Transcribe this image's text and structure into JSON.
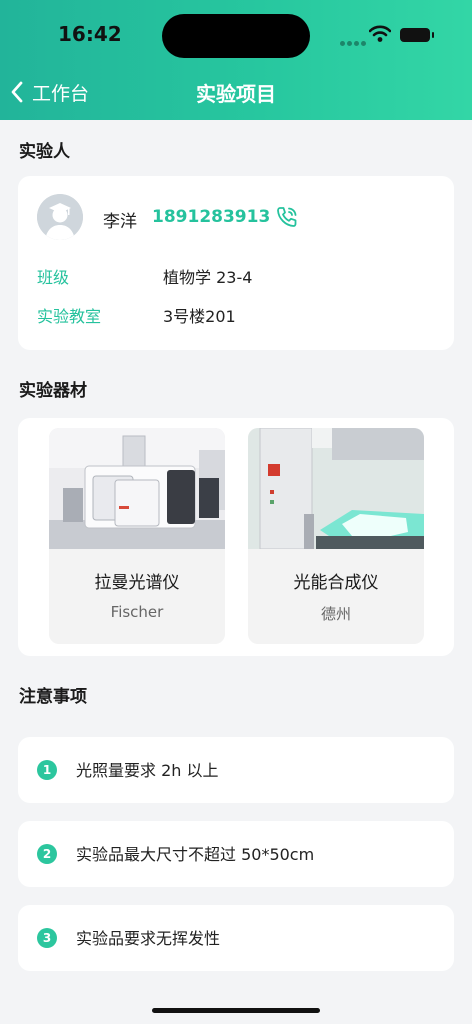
{
  "status_bar": {
    "time": "16:42"
  },
  "nav": {
    "back_label": "工作台",
    "title": "实验项目"
  },
  "experimenter": {
    "section_title": "实验人",
    "name": "李洋",
    "phone": "1891283913",
    "fields": [
      {
        "label": "班级",
        "value": "植物学 23-4"
      },
      {
        "label": "实验教室",
        "value": "3号楼201"
      }
    ]
  },
  "equipment": {
    "section_title": "实验器材",
    "items": [
      {
        "name": "拉曼光谱仪",
        "sub": "Fischer"
      },
      {
        "name": "光能合成仪",
        "sub": "德州"
      }
    ]
  },
  "notes": {
    "section_title": "注意事项",
    "items": [
      {
        "num": "1",
        "text": "光照量要求 2h 以上"
      },
      {
        "num": "2",
        "text": "实验品最大尺寸不超过 50*50cm"
      },
      {
        "num": "3",
        "text": "实验品要求无挥发性"
      }
    ]
  },
  "colors": {
    "accent": "#25c29d",
    "header_start": "#22b49a",
    "header_end": "#33d6a6",
    "background": "#f3f4f6"
  },
  "icons": [
    "back-chevron-icon",
    "phone-call-icon",
    "avatar-graduate-icon",
    "wifi-icon",
    "battery-icon"
  ]
}
